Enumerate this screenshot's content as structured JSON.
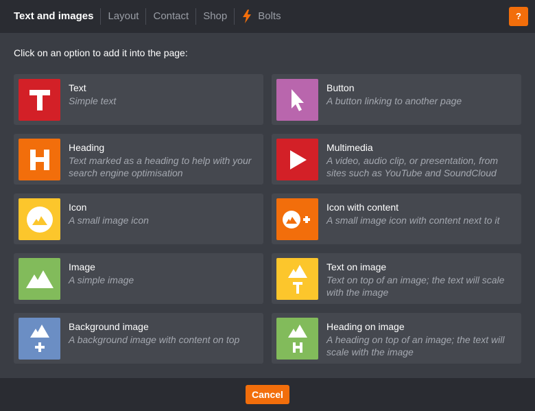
{
  "header": {
    "tabs": [
      {
        "label": "Text and images",
        "active": true
      },
      {
        "label": "Layout"
      },
      {
        "label": "Contact"
      },
      {
        "label": "Shop"
      },
      {
        "label": "Bolts",
        "icon": "bolt-icon"
      }
    ],
    "help_label": "?"
  },
  "instructions": "Click on an option to add it into the page:",
  "options": [
    {
      "title": "Text",
      "description": "Simple text",
      "icon": "text-t-icon",
      "color": "#d32027"
    },
    {
      "title": "Button",
      "description": "A button linking to another page",
      "icon": "cursor-pointer-icon",
      "color": "#b966ad"
    },
    {
      "title": "Heading",
      "description": "Text marked as a heading to help with your search engine optimisation",
      "icon": "heading-h-icon",
      "color": "#f26e0b"
    },
    {
      "title": "Multimedia",
      "description": "A video, audio clip, or presentation, from sites such as YouTube and SoundCloud",
      "icon": "play-icon",
      "color": "#d32027"
    },
    {
      "title": "Icon",
      "description": "A small image icon",
      "icon": "circle-mountain-icon",
      "color": "#fcc62c"
    },
    {
      "title": "Icon with content",
      "description": "A small image icon with content next to it",
      "icon": "circle-mountain-plus-icon",
      "color": "#f26e0b"
    },
    {
      "title": "Image",
      "description": "A simple image",
      "icon": "mountain-icon",
      "color": "#82bb5b"
    },
    {
      "title": "Text on image",
      "description": "Text on top of an image; the text will scale with the image",
      "icon": "mountain-text-icon",
      "color": "#fcc62c"
    },
    {
      "title": "Background image",
      "description": "A background image with content on top",
      "icon": "mountain-plus-icon",
      "color": "#6b8ec4"
    },
    {
      "title": "Heading on image",
      "description": "A heading on top of an image; the text will scale with the image",
      "icon": "mountain-heading-icon",
      "color": "#82bb5b"
    }
  ],
  "footer": {
    "cancel_label": "Cancel"
  },
  "colors": {
    "accent": "#f26e0b",
    "header_bg": "#2a2c32",
    "panel_bg": "#3a3d44",
    "card_bg": "#45484f"
  }
}
